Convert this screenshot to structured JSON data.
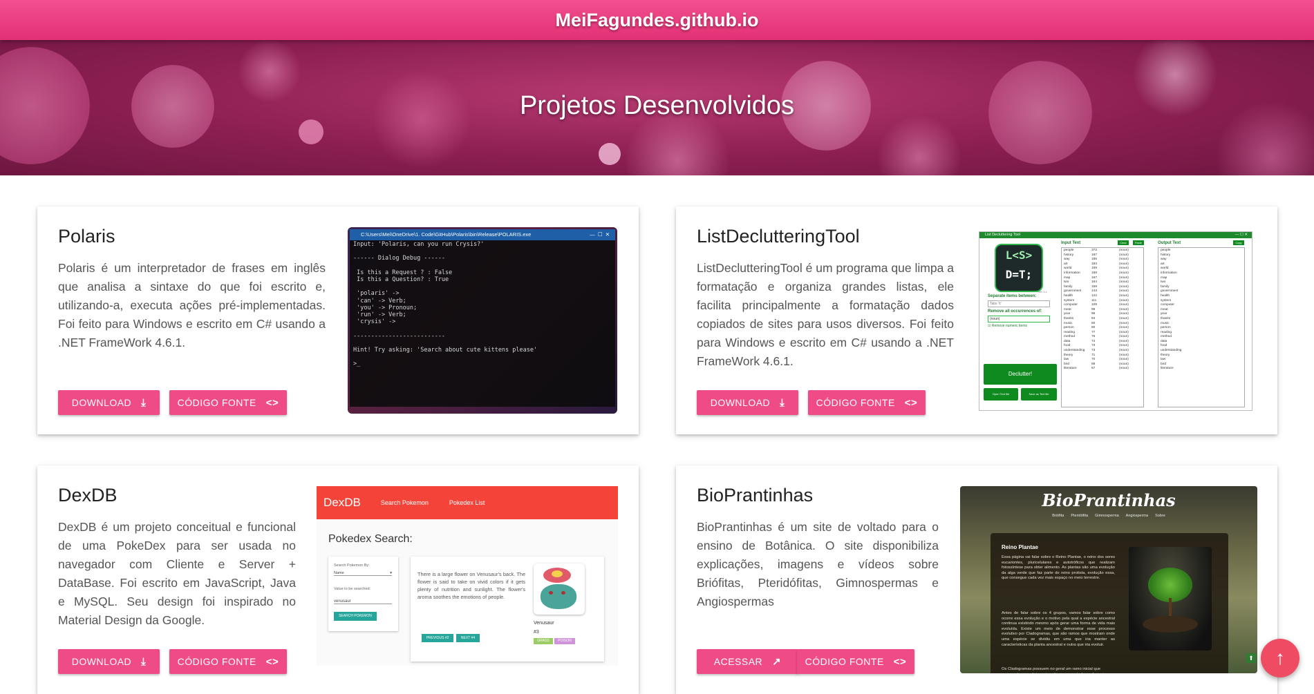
{
  "site_title": "MeiFagundes.github.io",
  "hero_title": "Projetos Desenvolvidos",
  "projects": [
    {
      "title": "Polaris",
      "description": "Polaris é um interpretador de frases em inglês que analisa a sintaxe do que foi escrito e, utilizando-a, executa ações pré-implementadas. Foi feito para Windows e escrito em C# usando a .NET FrameWork 4.6.1.",
      "btn1": "Download",
      "btn2": "Código Fonte",
      "screenshot": {
        "window_title": "C:\\Users\\Mei\\OneDrive\\1. Code\\GitHub\\Polaris\\bin\\Release\\POLARIS.exe",
        "lines": [
          "Input: 'Polaris, can you run Crysis?'",
          "",
          "------ Dialog Debug ------",
          "",
          " Is this a Request ? : False",
          " Is this a Question? : True",
          "",
          " 'polaris' ->",
          " 'can' -> Verb;",
          " 'you' -> Pronoun;",
          " 'run' -> Verb;",
          " 'crysis' ->",
          "",
          "--------------------------",
          "",
          "Hint! Try asking: 'Search about cute kittens please'",
          "",
          ">_"
        ]
      }
    },
    {
      "title": "ListDeclutteringTool",
      "description": "ListDeclutteringTool é um programa que limpa a formatação e organiza grandes listas, ele facilita principalmente a formatação dados copiados de sites para usos diversos. Foi feito para Windows e escrito em C# usando a .NET FrameWork 4.6.1.",
      "btn1": "Download",
      "btn2": "Código Fonte",
      "screenshot": {
        "window_title": "List Decluttering Tool",
        "logo_top": "L<S>",
        "logo_bottom": "D=T;",
        "version": "Ver 1.x",
        "separate_label": "Separate items between:",
        "separate_value": "Tabs '\\t'",
        "remove_label": "Remove all occurrences of:",
        "remove_value": "(noun)",
        "checkbox_label": "Remove numeric items",
        "declutter": "Declutter!",
        "open_file": "Open Text file",
        "save_file": "Save as Text file",
        "input_label": "Input Text",
        "output_label": "Output Text",
        "clear": "Clear",
        "paste": "Paste",
        "copy": "Copy",
        "input_rows": [
          [
            "people",
            "372",
            "(noun)"
          ],
          [
            "history",
            "187",
            "(noun)"
          ],
          [
            "way",
            "185",
            "(noun)"
          ],
          [
            "art",
            "183",
            "(noun)"
          ],
          [
            "world",
            "169",
            "(noun)"
          ],
          [
            "information",
            "168",
            "(noun)"
          ],
          [
            "map",
            "167",
            "(noun)"
          ],
          [
            "two",
            "164",
            "(noun)"
          ],
          [
            "family",
            "159",
            "(noun)"
          ],
          [
            "government",
            "143",
            "(noun)"
          ],
          [
            "health",
            "122",
            "(noun)"
          ],
          [
            "system",
            "111",
            "(noun)"
          ],
          [
            "computer",
            "109",
            "(noun)"
          ],
          [
            "meat",
            "99",
            "(noun)"
          ],
          [
            "year",
            "96",
            "(noun)"
          ],
          [
            "thanks",
            "84",
            "(noun)"
          ],
          [
            "music",
            "80",
            "(noun)"
          ],
          [
            "person",
            "80",
            "(noun)"
          ],
          [
            "reading",
            "77",
            "(noun)"
          ],
          [
            "method",
            "76",
            "(noun)"
          ],
          [
            "data",
            "74",
            "(noun)"
          ],
          [
            "food",
            "73",
            "(noun)"
          ],
          [
            "understanding",
            "73",
            "(noun)"
          ],
          [
            "theory",
            "71",
            "(noun)"
          ],
          [
            "law",
            "70",
            "(noun)"
          ],
          [
            "bird",
            "68",
            "(noun)"
          ],
          [
            "literature",
            "67",
            "(noun)"
          ]
        ],
        "output_rows": [
          "people",
          "history",
          "way",
          "art",
          "world",
          "information",
          "map",
          "two",
          "family",
          "government",
          "health",
          "system",
          "computer",
          "meat",
          "year",
          "thanks",
          "music",
          "person",
          "reading",
          "method",
          "data",
          "food",
          "understanding",
          "theory",
          "law",
          "bird",
          "literature"
        ]
      }
    },
    {
      "title": "DexDB",
      "description": "DexDB é um projeto conceitual e funcional de uma PokeDex para ser usada no navegador com Cliente e Server + DataBase. Foi escrito em JavaScript, Java e MySQL. Seu design foi inspirado no Material Design da Google.",
      "btn1": "Download",
      "btn2": "Código Fonte",
      "screenshot": {
        "brand": "DexDB",
        "nav1": "Search Pokemon",
        "nav2": "Pokedex List",
        "heading": "Pokedex Search:",
        "search_by": "Search Pokemon By:",
        "select_value": "Name",
        "value_label": "Value to be searched:",
        "value": "venusaur",
        "search_btn": "Search Pokemon",
        "flavor": "There is a large flower on Venusaur's back. The flower is said to take on vivid colors if it gets plenty of nutrition and sunlight. The flower's aroma soothes the emotions of people.",
        "poke_name": "Venusaur",
        "poke_num": "#3",
        "type1": "Grass",
        "type2": "Poison",
        "prev": "Previous #2",
        "next": "Next #4"
      }
    },
    {
      "title": "BioPrantinhas",
      "description": "BioPrantinhas é um site de voltado para o ensino de Botânica. O site disponibiliza explicações, imagens e vídeos sobre Briófitas, Pteridófitas, Gimnospermas e Angiospermas",
      "btn1": "Acessar",
      "btn2": "Código Fonte",
      "screenshot": {
        "brand": "BioPrantinhas",
        "nav": [
          "Briófita",
          "Pteridófita",
          "Gimnosperma",
          "Angiosperma",
          "Sobre"
        ],
        "panel_title": "Reino Plantae",
        "p1": "Essa página vai falar sobre o Reino Plantae, o reino dos seres eucariontes, pluricelulares e autotróficos que realizam fotossíntese para obter alimento. As plantas são uma evolução da alga verde que faz parte do reino protista, evolução essa, que consegue cada vez mais espaço no meio terrestre.",
        "p2": "Antes de falar sobre os 4 grupos, vamos falar sobre como ocorre essa evolução e o motivo pela qual a espécie ancestral continua existindo mesmo após gerar uma forma de vida mais evoluída. Existe um meio de demonstrar esse processo evolutivo por Cladogramas, que são ramos que mostram onde uma espécie se dividiu em uma que iria manter as características da planta ancestral e outra que iria evoluir.",
        "p3": "Os Cladogramas possuem no geral um ramo inicial que representa a espécie mais antiga, a ancestral que deu origem a todas as outras mostradas aí. Esse ramo inicial"
      }
    }
  ]
}
